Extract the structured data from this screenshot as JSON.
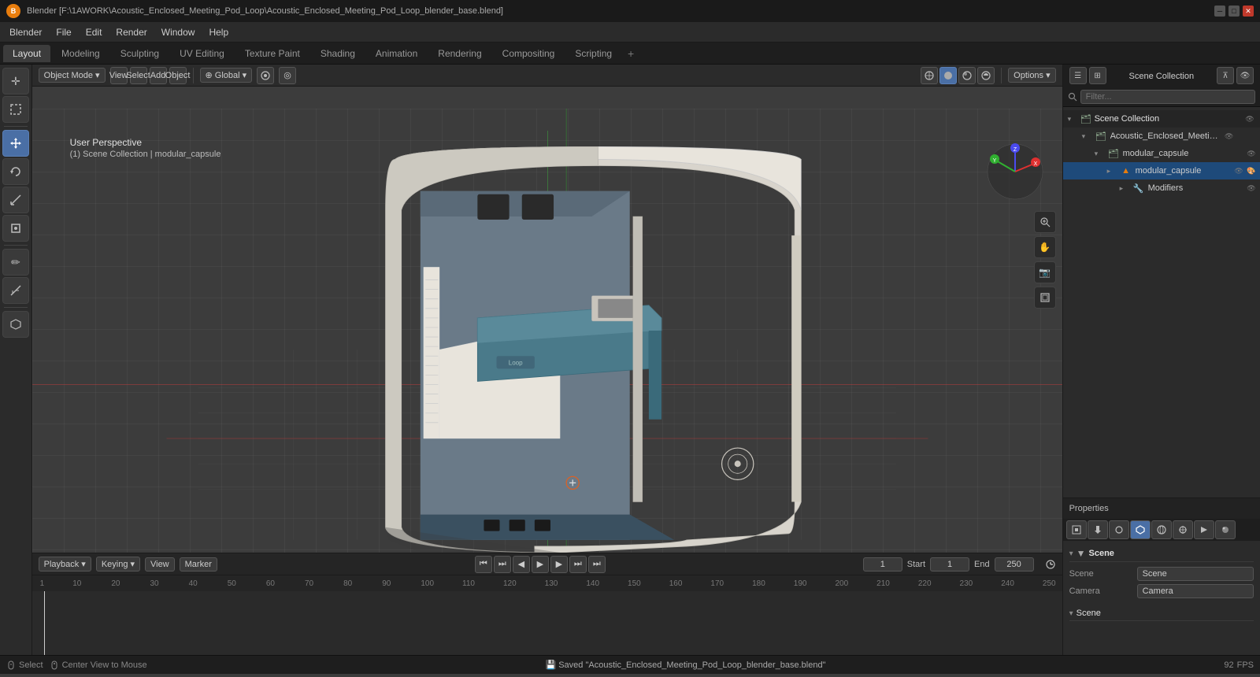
{
  "titlebar": {
    "title": "Blender [F:\\1AWORK\\Acoustic_Enclosed_Meeting_Pod_Loop\\Acoustic_Enclosed_Meeting_Pod_Loop_blender_base.blend]",
    "logo": "B"
  },
  "menu": {
    "items": [
      "Blender",
      "File",
      "Edit",
      "Render",
      "Window",
      "Help"
    ]
  },
  "workspace_tabs": {
    "tabs": [
      "Layout",
      "Modeling",
      "Sculpting",
      "UV Editing",
      "Texture Paint",
      "Shading",
      "Animation",
      "Rendering",
      "Compositing",
      "Scripting"
    ],
    "active": "Layout",
    "add_label": "+"
  },
  "viewport_header": {
    "mode": "Object Mode",
    "view_label": "View",
    "select_label": "Select",
    "add_label": "Add",
    "object_label": "Object",
    "transform": "Global",
    "options_label": "Options"
  },
  "viewport_info": {
    "perspective": "User Perspective",
    "collection": "(1) Scene Collection | modular_capsule"
  },
  "left_toolbar": {
    "tools": [
      {
        "name": "cursor-tool",
        "icon": "✛",
        "active": false
      },
      {
        "name": "move-tool",
        "icon": "⊕",
        "active": false
      },
      {
        "name": "rotate-tool",
        "icon": "↻",
        "active": false
      },
      {
        "name": "scale-tool",
        "icon": "⤡",
        "active": false
      },
      {
        "name": "transform-tool",
        "icon": "⊞",
        "active": true
      },
      {
        "name": "annotate-tool",
        "icon": "✏",
        "active": false
      },
      {
        "name": "measure-tool",
        "icon": "📏",
        "active": false
      },
      {
        "name": "add-cube-tool",
        "icon": "⬜",
        "active": false
      }
    ]
  },
  "outliner": {
    "title": "Scene Collection",
    "search_placeholder": "Filter...",
    "items": [
      {
        "id": "scene-collection",
        "label": "Scene Collection",
        "icon": "🗂",
        "indent": 0,
        "expanded": true,
        "selected": false
      },
      {
        "id": "acoustic-collection",
        "label": "Acoustic_Enclosed_Meeting_Pod_",
        "icon": "🗂",
        "indent": 1,
        "expanded": true,
        "selected": false
      },
      {
        "id": "modular-capsule-col",
        "label": "modular_capsule",
        "icon": "🗂",
        "indent": 2,
        "expanded": true,
        "selected": false
      },
      {
        "id": "modular-capsule-obj",
        "label": "modular_capsule",
        "icon": "▲",
        "indent": 3,
        "expanded": false,
        "selected": true
      },
      {
        "id": "modifiers",
        "label": "Modifiers",
        "icon": "🔧",
        "indent": 4,
        "expanded": false,
        "selected": false
      }
    ]
  },
  "properties": {
    "active_tab": "scene",
    "tabs": [
      "scene",
      "render",
      "output",
      "view_layer",
      "scene2",
      "world",
      "object",
      "modifier",
      "particles",
      "physics",
      "constraints",
      "data",
      "material"
    ],
    "scene_label": "Scene",
    "scene_value": "Scene",
    "camera_label": "Camera",
    "camera_value": "Camera"
  },
  "timeline": {
    "playback_label": "Playback",
    "keying_label": "Keying",
    "view_label": "View",
    "marker_label": "Marker",
    "current_frame": "1",
    "start_frame": "1",
    "end_frame": "250",
    "start_label": "Start",
    "end_label": "End",
    "ruler_marks": [
      "1",
      "10",
      "20",
      "30",
      "40",
      "50",
      "60",
      "70",
      "80",
      "90",
      "100",
      "110",
      "120",
      "130",
      "140",
      "150",
      "160",
      "170",
      "180",
      "190",
      "200",
      "210",
      "220",
      "230",
      "240",
      "250"
    ]
  },
  "status_bar": {
    "select_label": "Select",
    "center_view_label": "Center View to Mouse",
    "saved_message": "Saved \"Acoustic_Enclosed_Meeting_Pod_Loop_blender_base.blend\"",
    "frame_rate": "92",
    "mouse_icon": "🖱"
  },
  "right_panel_top": {
    "icons": [
      "☰",
      "⊞",
      "🔍",
      "⊼"
    ]
  },
  "gizmo": {
    "x_label": "X",
    "y_label": "Y",
    "z_label": "Z"
  }
}
